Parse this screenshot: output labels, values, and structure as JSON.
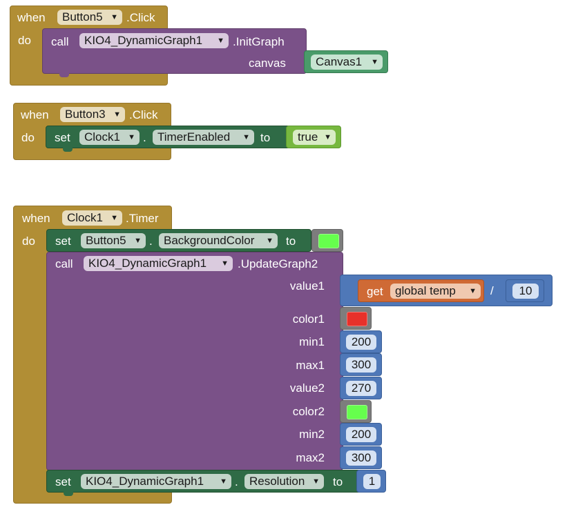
{
  "colors": {
    "event": "#b18e35",
    "procedure": "#7a5188",
    "setter": "#2f6b46",
    "math": "#4f78b8",
    "color_block": "#7d7d7d",
    "variable": "#cf6a35",
    "component": "#4a9b6a",
    "logic": "#77b83f",
    "swatch_green": "#66ff4d",
    "swatch_red": "#e8312a"
  },
  "block1": {
    "when": "when",
    "component": "Button5",
    "event": ".Click",
    "do": "do",
    "call": "call",
    "graph": "KIO4_DynamicGraph1",
    "method": ".InitGraph",
    "canvas_label": "canvas",
    "canvas_value": "Canvas1"
  },
  "block2": {
    "when": "when",
    "component": "Button3",
    "event": ".Click",
    "do": "do",
    "set": "set",
    "clock": "Clock1",
    "dot": ".",
    "property": "TimerEnabled",
    "to": "to",
    "value": "true"
  },
  "block3": {
    "when": "when",
    "component": "Clock1",
    "event": ".Timer",
    "do": "do",
    "set1": {
      "set": "set",
      "component": "Button5",
      "dot": ".",
      "property": "BackgroundColor",
      "to": "to"
    },
    "call": "call",
    "graph": "KIO4_DynamicGraph1",
    "method": ".UpdateGraph2",
    "value1_label": "value1",
    "get": "get",
    "var": "global temp",
    "divide": "/",
    "divisor": "10",
    "color1_label": "color1",
    "min1_label": "min1",
    "min1": "200",
    "max1_label": "max1",
    "max1": "300",
    "value2_label": "value2",
    "value2": "270",
    "color2_label": "color2",
    "min2_label": "min2",
    "min2": "200",
    "max2_label": "max2",
    "max2": "300",
    "set2": {
      "set": "set",
      "component": "KIO4_DynamicGraph1",
      "dot": ".",
      "property": "Resolution",
      "to": "to",
      "value": "1"
    }
  },
  "icons": {
    "dropdown": "▼"
  }
}
